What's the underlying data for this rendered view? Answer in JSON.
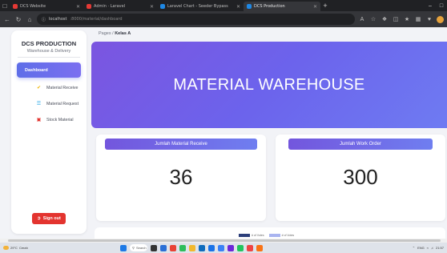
{
  "browser": {
    "tabs": [
      {
        "label": "DCS Website",
        "color": "#e53935",
        "active": false
      },
      {
        "label": "Admin · Laravel",
        "color": "#e53935",
        "active": false
      },
      {
        "label": "Laravel Chart - Seeder Bypass",
        "color": "#1e88e5",
        "active": false
      },
      {
        "label": "DCS Production",
        "color": "#1e88e5",
        "active": true
      }
    ],
    "address": {
      "host": "localhost",
      "path": ":8000/material/dashboard"
    }
  },
  "sidebar": {
    "brand_title": "DCS PRODUCTION",
    "brand_subtitle": "Warehouse & Delivery",
    "active_item": "Dashboard",
    "items": [
      {
        "label": "Material Receive",
        "icon": "check-icon",
        "color": "#f0b400"
      },
      {
        "label": "Material Request",
        "icon": "list-icon",
        "color": "#2aa8e8"
      },
      {
        "label": "Stock Material",
        "icon": "box-icon",
        "color": "#e3342f"
      }
    ],
    "signout_label": "Sign out"
  },
  "breadcrumb": {
    "parent": "Pages",
    "separator": "/",
    "current": "Kelas A"
  },
  "hero": {
    "title": "MATERIAL WAREHOUSE"
  },
  "cards": [
    {
      "header": "Jumlah Material Receive",
      "value": "36"
    },
    {
      "header": "Jumlah Work Order",
      "value": "300"
    }
  ],
  "chart_legend": [
    {
      "label": "# of Votes",
      "color": "#2c3e7a"
    },
    {
      "label": "# of Votes",
      "color": "#a9b4f0"
    }
  ],
  "taskbar": {
    "weather_temp": "29°C",
    "weather_text": "Cerah",
    "search_label": "Search",
    "tray_text": "ENG",
    "time": "21:57"
  },
  "colors": {
    "accent": "#6c63ec",
    "danger": "#e3342f",
    "page_bg": "#f2f3f7"
  }
}
